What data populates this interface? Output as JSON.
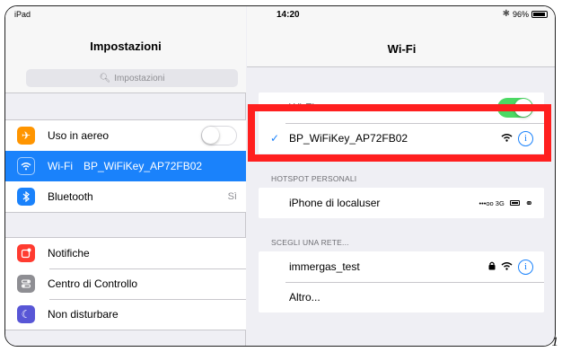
{
  "status_bar": {
    "device": "iPad",
    "time": "14:20",
    "battery": "96%"
  },
  "settings": {
    "title": "Impostazioni",
    "search_placeholder": "Impostazioni",
    "group1": [
      {
        "label": "Uso in aereo",
        "icon": "airplane-icon",
        "color": "#ff9500",
        "control": "toggle-off"
      },
      {
        "label": "Wi-Fi",
        "icon": "wifi-icon",
        "color": "#1a82fb",
        "value": "BP_WiFiKey_AP72FB02",
        "selected": true
      },
      {
        "label": "Bluetooth",
        "icon": "bluetooth-icon",
        "color": "#1a82fb",
        "value": "Sì"
      }
    ],
    "group2": [
      {
        "label": "Notifiche",
        "icon": "notifications-icon",
        "color": "#ff3b30"
      },
      {
        "label": "Centro di Controllo",
        "icon": "control-center-icon",
        "color": "#8e8e93"
      },
      {
        "label": "Non disturbare",
        "icon": "moon-icon",
        "color": "#5856d6"
      }
    ]
  },
  "wifi": {
    "title": "Wi-Fi",
    "wifi_label": "Wi-Fi",
    "wifi_enabled": true,
    "connected_network": "BP_WiFiKey_AP72FB02",
    "hotspot_section": "HOTSPOT PERSONALI",
    "hotspot": {
      "name": "iPhone di localuser",
      "signal": "•••oo 3G"
    },
    "networks_section": "SCEGLI UNA RETE...",
    "networks": [
      {
        "name": "immergas_test",
        "locked": true
      },
      {
        "name": "Altro..."
      }
    ]
  },
  "accent_color": "#1a82fb",
  "highlight_color": "#ff1f1f",
  "page_number": "1"
}
